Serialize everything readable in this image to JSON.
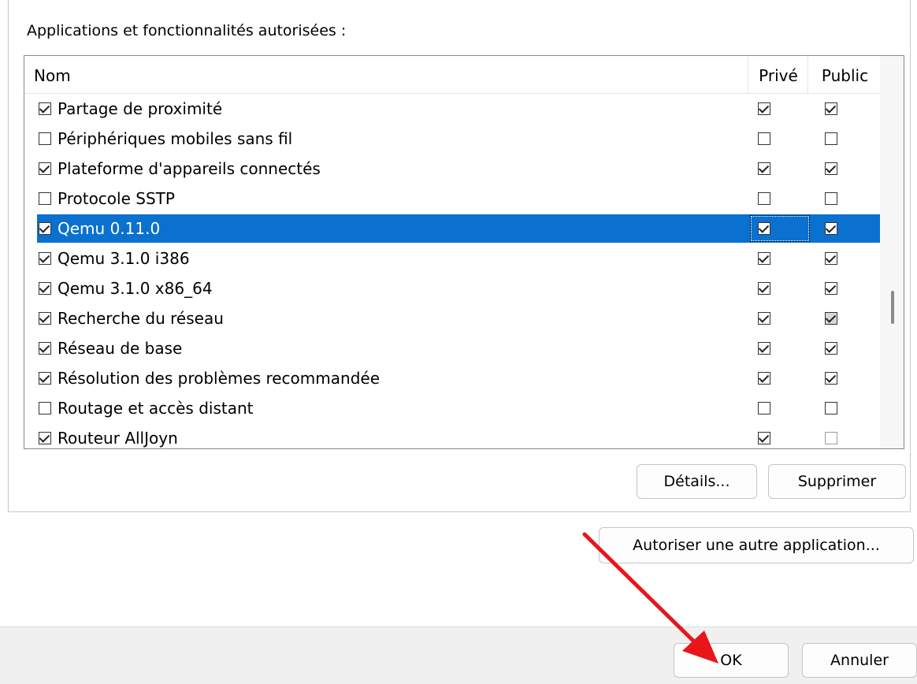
{
  "section_label": "Applications et fonctionnalités autorisées :",
  "columns": {
    "name": "Nom",
    "private": "Privé",
    "public": "Public"
  },
  "rows": [
    {
      "label": "Partage de proximité",
      "enabled": true,
      "private": true,
      "public": true
    },
    {
      "label": "Périphériques mobiles sans fil",
      "enabled": false,
      "private": false,
      "public": false
    },
    {
      "label": "Plateforme d'appareils connectés",
      "enabled": true,
      "private": true,
      "public": true
    },
    {
      "label": "Protocole SSTP",
      "enabled": false,
      "private": false,
      "public": false
    },
    {
      "label": "Qemu 0.11.0",
      "enabled": true,
      "private": true,
      "public": true,
      "selected": true
    },
    {
      "label": "Qemu 3.1.0 i386",
      "enabled": true,
      "private": true,
      "public": true
    },
    {
      "label": "Qemu 3.1.0 x86_64",
      "enabled": true,
      "private": true,
      "public": true
    },
    {
      "label": "Recherche du réseau",
      "enabled": true,
      "private": true,
      "public": true,
      "public_gray": true
    },
    {
      "label": "Réseau de base",
      "enabled": true,
      "private": true,
      "public": true
    },
    {
      "label": "Résolution des problèmes recommandée",
      "enabled": true,
      "private": true,
      "public": true
    },
    {
      "label": "Routage et accès distant",
      "enabled": false,
      "private": false,
      "public": false
    },
    {
      "label": "Routeur AllJoyn",
      "enabled": true,
      "private": true,
      "public": false,
      "public_faded": true
    }
  ],
  "buttons": {
    "details": "Détails...",
    "delete": "Supprimer",
    "allow_other": "Autoriser une autre application...",
    "ok": "OK",
    "cancel": "Annuler"
  },
  "colors": {
    "selection": "#0a71cf",
    "arrow": "#e8161b"
  },
  "icons": {
    "checkbox_checked": "checkbox-checked-icon",
    "checkbox_unchecked": "checkbox-unchecked-icon",
    "annotation_arrow": "red-arrow-icon"
  }
}
